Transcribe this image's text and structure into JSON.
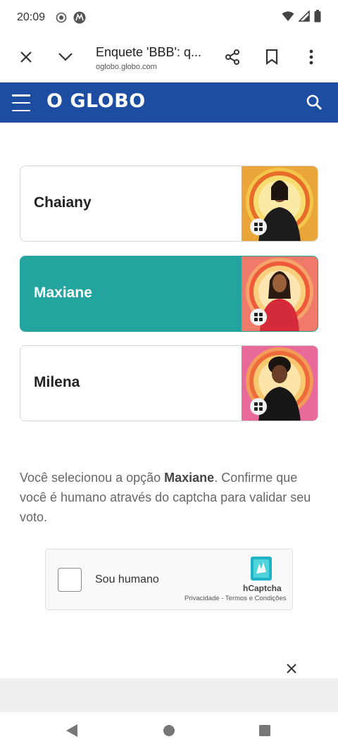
{
  "status_bar": {
    "time": "20:09"
  },
  "browser": {
    "title": "Enquete 'BBB': q...",
    "domain": "oglobo.globo.com"
  },
  "header": {
    "logo": "O GLOBO"
  },
  "options": [
    {
      "name": "Chaiany",
      "selected": false
    },
    {
      "name": "Maxiane",
      "selected": true
    },
    {
      "name": "Milena",
      "selected": false
    }
  ],
  "message": {
    "before": "Você selecionou a opção ",
    "choice": "Maxiane",
    "after": ". Confirme que você é humano através do captcha para validar seu voto."
  },
  "captcha": {
    "label": "Sou humano",
    "brand": "hCaptcha",
    "links": "Privacidade - Termos e Condições"
  },
  "colors": {
    "header_bg": "#1d4da1",
    "selected_bg": "#23a49e"
  }
}
